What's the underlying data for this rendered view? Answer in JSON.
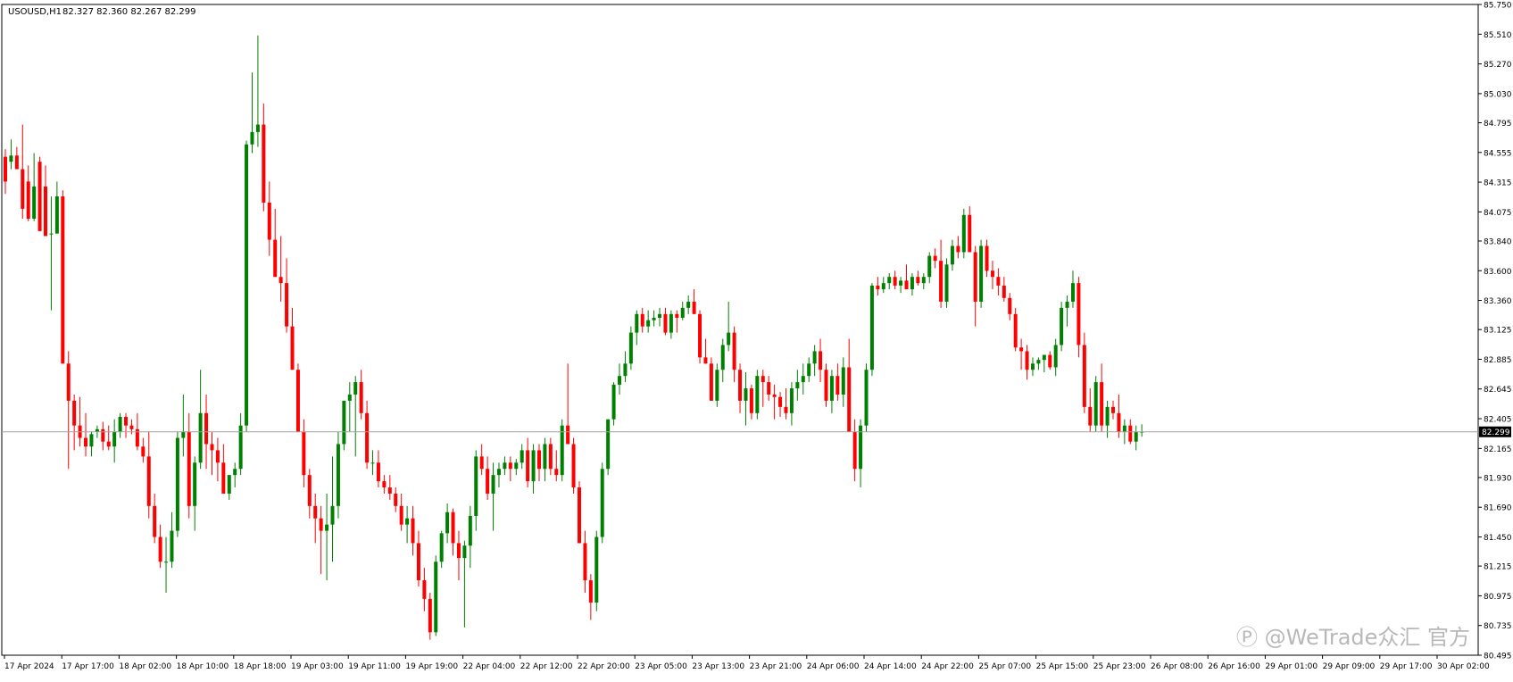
{
  "header": {
    "symbol": "USOUSD,H1",
    "ohlc": "82.327 82.360 82.267 82.299"
  },
  "watermark": "Ⓟ @WeTrade众汇 官方",
  "colors": {
    "bull": "#008000",
    "bear": "#ff0000",
    "wick_bull": "#008000",
    "wick_bear": "#ff0000",
    "bid_line": "#a0a0a0",
    "axis": "#000000",
    "price_label_bg": "#000000",
    "price_label_fg": "#ffffff"
  },
  "chart_data": {
    "type": "candlestick",
    "title": "",
    "current_price": 82.299,
    "current_price_label": "82.299",
    "ylim": [
      80.495,
      85.75
    ],
    "y_ticks": [
      "85.750",
      "85.510",
      "85.270",
      "85.030",
      "84.795",
      "84.555",
      "84.315",
      "84.075",
      "83.840",
      "83.600",
      "83.360",
      "83.125",
      "82.885",
      "82.645",
      "82.405",
      "82.165",
      "81.930",
      "81.690",
      "81.450",
      "81.215",
      "80.975",
      "80.735",
      "80.495"
    ],
    "x_ticks": [
      "17 Apr 2024",
      "17 Apr 17:00",
      "18 Apr 02:00",
      "18 Apr 10:00",
      "18 Apr 18:00",
      "19 Apr 03:00",
      "19 Apr 11:00",
      "19 Apr 19:00",
      "22 Apr 04:00",
      "22 Apr 12:00",
      "22 Apr 20:00",
      "23 Apr 05:00",
      "23 Apr 13:00",
      "23 Apr 21:00",
      "24 Apr 06:00",
      "24 Apr 14:00",
      "24 Apr 22:00",
      "25 Apr 07:00",
      "25 Apr 15:00",
      "25 Apr 23:00",
      "26 Apr 08:00",
      "26 Apr 16:00",
      "29 Apr 01:00",
      "29 Apr 09:00",
      "29 Apr 17:00",
      "30 Apr 02:00"
    ],
    "candles": [
      [
        84.52,
        84.58,
        84.22,
        84.32
      ],
      [
        84.48,
        84.66,
        84.42,
        84.53
      ],
      [
        84.53,
        84.6,
        84.42,
        84.42
      ],
      [
        84.42,
        84.78,
        84.02,
        84.1
      ],
      [
        84.32,
        84.45,
        84.0,
        84.02
      ],
      [
        84.02,
        84.55,
        84.0,
        84.28
      ],
      [
        84.48,
        84.52,
        83.92,
        83.92
      ],
      [
        84.28,
        84.45,
        83.88,
        83.88
      ],
      [
        83.9,
        84.2,
        83.28,
        83.9
      ],
      [
        83.9,
        84.32,
        83.9,
        84.2
      ],
      [
        84.2,
        84.25,
        82.85,
        82.85
      ],
      [
        82.85,
        82.95,
        82.0,
        82.55
      ],
      [
        82.55,
        82.6,
        82.15,
        82.35
      ],
      [
        82.35,
        82.58,
        82.18,
        82.25
      ],
      [
        82.25,
        82.45,
        82.1,
        82.18
      ],
      [
        82.18,
        82.3,
        82.1,
        82.28
      ],
      [
        82.3,
        82.35,
        82.25,
        82.32
      ],
      [
        82.32,
        82.38,
        82.15,
        82.22
      ],
      [
        82.22,
        82.35,
        82.15,
        82.18
      ],
      [
        82.18,
        82.4,
        82.05,
        82.3
      ],
      [
        82.3,
        82.45,
        82.25,
        82.42
      ],
      [
        82.42,
        82.45,
        82.25,
        82.35
      ],
      [
        82.35,
        82.4,
        82.28,
        82.32
      ],
      [
        82.32,
        82.45,
        82.15,
        82.18
      ],
      [
        82.18,
        82.25,
        82.05,
        82.1
      ],
      [
        82.1,
        82.3,
        81.6,
        81.7
      ],
      [
        81.7,
        81.8,
        81.4,
        81.45
      ],
      [
        81.45,
        81.55,
        81.2,
        81.25
      ],
      [
        81.25,
        81.45,
        81.0,
        81.25
      ],
      [
        81.25,
        81.65,
        81.2,
        81.5
      ],
      [
        81.5,
        82.3,
        81.45,
        82.25
      ],
      [
        82.25,
        82.6,
        82.1,
        82.3
      ],
      [
        82.3,
        82.45,
        81.6,
        81.7
      ],
      [
        81.7,
        82.1,
        81.5,
        82.05
      ],
      [
        82.05,
        82.8,
        82.0,
        82.45
      ],
      [
        82.45,
        82.6,
        82.0,
        82.2
      ],
      [
        82.2,
        82.3,
        81.95,
        82.15
      ],
      [
        82.15,
        82.25,
        81.9,
        82.05
      ],
      [
        82.05,
        82.2,
        81.85,
        81.8
      ],
      [
        81.8,
        81.95,
        81.75,
        81.95
      ],
      [
        81.95,
        82.05,
        81.85,
        82.0
      ],
      [
        82.0,
        82.45,
        81.95,
        82.35
      ],
      [
        82.35,
        84.65,
        82.3,
        84.62
      ],
      [
        84.62,
        85.2,
        84.55,
        84.72
      ],
      [
        84.72,
        85.5,
        84.6,
        84.78
      ],
      [
        84.78,
        84.95,
        84.08,
        84.15
      ],
      [
        84.15,
        84.32,
        83.72,
        83.85
      ],
      [
        83.85,
        84.1,
        83.55,
        83.55
      ],
      [
        83.55,
        83.88,
        83.35,
        83.5
      ],
      [
        83.5,
        83.7,
        83.1,
        83.15
      ],
      [
        83.15,
        83.3,
        82.8,
        82.8
      ],
      [
        82.8,
        82.85,
        82.3,
        82.3
      ],
      [
        82.3,
        82.4,
        81.85,
        81.95
      ],
      [
        81.95,
        82.0,
        81.6,
        81.7
      ],
      [
        81.7,
        81.8,
        81.4,
        81.6
      ],
      [
        81.6,
        81.7,
        81.15,
        81.5
      ],
      [
        81.5,
        81.8,
        81.1,
        81.55
      ],
      [
        81.55,
        82.1,
        81.25,
        81.7
      ],
      [
        81.7,
        82.3,
        81.6,
        82.2
      ],
      [
        82.2,
        82.55,
        82.15,
        82.55
      ],
      [
        82.55,
        82.7,
        82.3,
        82.6
      ],
      [
        82.6,
        82.75,
        82.1,
        82.7
      ],
      [
        82.7,
        82.8,
        82.4,
        82.45
      ],
      [
        82.45,
        82.55,
        82.0,
        82.05
      ],
      [
        82.05,
        82.15,
        81.95,
        82.05
      ],
      [
        82.05,
        82.15,
        81.85,
        81.9
      ],
      [
        81.9,
        81.95,
        81.8,
        81.85
      ],
      [
        81.85,
        81.95,
        81.75,
        81.8
      ],
      [
        81.8,
        81.85,
        81.65,
        81.7
      ],
      [
        81.7,
        81.8,
        81.5,
        81.55
      ],
      [
        81.55,
        81.7,
        81.4,
        81.6
      ],
      [
        81.6,
        81.7,
        81.3,
        81.4
      ],
      [
        81.4,
        81.5,
        81.05,
        81.1
      ],
      [
        81.1,
        81.2,
        80.85,
        80.95
      ],
      [
        80.95,
        81.0,
        80.62,
        80.68
      ],
      [
        80.68,
        81.3,
        80.65,
        81.25
      ],
      [
        81.25,
        81.5,
        81.2,
        81.48
      ],
      [
        81.48,
        81.72,
        81.4,
        81.65
      ],
      [
        81.65,
        81.68,
        81.3,
        81.4
      ],
      [
        81.4,
        81.5,
        81.1,
        81.28
      ],
      [
        81.28,
        81.42,
        80.72,
        81.38
      ],
      [
        81.38,
        81.7,
        81.2,
        81.62
      ],
      [
        81.62,
        82.15,
        81.5,
        82.1
      ],
      [
        82.1,
        82.2,
        81.95,
        82.0
      ],
      [
        82.0,
        82.1,
        81.75,
        81.8
      ],
      [
        81.8,
        82.05,
        81.5,
        81.95
      ],
      [
        81.95,
        82.05,
        81.85,
        82.0
      ],
      [
        82.0,
        82.1,
        81.95,
        82.05
      ],
      [
        82.05,
        82.1,
        81.9,
        82.0
      ],
      [
        82.0,
        82.08,
        81.95,
        82.05
      ],
      [
        82.05,
        82.2,
        82.0,
        82.15
      ],
      [
        82.15,
        82.25,
        81.85,
        81.9
      ],
      [
        81.9,
        82.2,
        81.8,
        82.15
      ],
      [
        82.15,
        82.2,
        81.9,
        82.0
      ],
      [
        82.0,
        82.25,
        81.9,
        82.2
      ],
      [
        82.2,
        82.25,
        81.95,
        82.0
      ],
      [
        82.0,
        82.15,
        81.9,
        81.95
      ],
      [
        81.95,
        82.4,
        81.9,
        82.35
      ],
      [
        82.35,
        82.85,
        82.2,
        82.2
      ],
      [
        82.2,
        82.25,
        81.8,
        81.85
      ],
      [
        81.85,
        81.9,
        81.4,
        81.4
      ],
      [
        81.4,
        81.5,
        81.0,
        81.1
      ],
      [
        81.1,
        81.15,
        80.78,
        80.92
      ],
      [
        80.92,
        81.5,
        80.85,
        81.45
      ],
      [
        81.45,
        82.05,
        81.4,
        82.0
      ],
      [
        82.0,
        82.4,
        81.95,
        82.4
      ],
      [
        82.4,
        82.7,
        82.35,
        82.68
      ],
      [
        82.68,
        82.85,
        82.6,
        82.75
      ],
      [
        82.75,
        82.95,
        82.7,
        82.85
      ],
      [
        82.85,
        83.15,
        82.8,
        83.1
      ],
      [
        83.1,
        83.28,
        83.0,
        83.25
      ],
      [
        83.25,
        83.3,
        83.1,
        83.15
      ],
      [
        83.15,
        83.28,
        83.1,
        83.2
      ],
      [
        83.2,
        83.28,
        83.15,
        83.22
      ],
      [
        83.22,
        83.3,
        83.15,
        83.25
      ],
      [
        83.25,
        83.3,
        83.08,
        83.1
      ],
      [
        83.1,
        83.28,
        83.05,
        83.25
      ],
      [
        83.25,
        83.28,
        83.1,
        83.22
      ],
      [
        83.22,
        83.35,
        83.2,
        83.3
      ],
      [
        83.3,
        83.4,
        83.25,
        83.35
      ],
      [
        83.35,
        83.45,
        83.25,
        83.25
      ],
      [
        83.25,
        83.28,
        82.85,
        82.9
      ],
      [
        82.9,
        83.05,
        82.85,
        82.85
      ],
      [
        82.85,
        82.9,
        82.55,
        82.55
      ],
      [
        82.55,
        82.85,
        82.5,
        82.8
      ],
      [
        82.8,
        83.05,
        82.7,
        83.0
      ],
      [
        83.0,
        83.35,
        82.95,
        83.1
      ],
      [
        83.1,
        83.15,
        82.7,
        82.8
      ],
      [
        82.8,
        82.85,
        82.45,
        82.55
      ],
      [
        82.55,
        82.78,
        82.35,
        82.65
      ],
      [
        82.65,
        82.68,
        82.4,
        82.45
      ],
      [
        82.45,
        82.8,
        82.4,
        82.75
      ],
      [
        82.75,
        82.8,
        82.5,
        82.7
      ],
      [
        82.7,
        82.75,
        82.55,
        82.6
      ],
      [
        82.6,
        82.68,
        82.4,
        82.58
      ],
      [
        82.58,
        82.62,
        82.42,
        82.5
      ],
      [
        82.5,
        82.65,
        82.4,
        82.45
      ],
      [
        82.45,
        82.7,
        82.35,
        82.65
      ],
      [
        82.65,
        82.8,
        82.55,
        82.7
      ],
      [
        82.7,
        82.85,
        82.6,
        82.75
      ],
      [
        82.75,
        82.9,
        82.7,
        82.85
      ],
      [
        82.85,
        83.0,
        82.75,
        82.95
      ],
      [
        82.95,
        83.05,
        82.7,
        82.8
      ],
      [
        82.8,
        82.85,
        82.5,
        82.55
      ],
      [
        82.55,
        82.8,
        82.45,
        82.75
      ],
      [
        82.75,
        82.85,
        82.55,
        82.6
      ],
      [
        82.6,
        82.9,
        82.5,
        82.82
      ],
      [
        82.82,
        83.05,
        82.35,
        82.3
      ],
      [
        82.3,
        82.4,
        81.9,
        82.0
      ],
      [
        82.0,
        82.4,
        81.85,
        82.35
      ],
      [
        82.35,
        82.85,
        82.3,
        82.8
      ],
      [
        82.8,
        83.5,
        82.75,
        83.48
      ],
      [
        83.48,
        83.55,
        83.4,
        83.45
      ],
      [
        83.45,
        83.55,
        83.42,
        83.5
      ],
      [
        83.5,
        83.58,
        83.45,
        83.55
      ],
      [
        83.55,
        83.6,
        83.45,
        83.48
      ],
      [
        83.48,
        83.55,
        83.42,
        83.52
      ],
      [
        83.52,
        83.65,
        83.45,
        83.45
      ],
      [
        83.45,
        83.58,
        83.4,
        83.55
      ],
      [
        83.55,
        83.6,
        83.48,
        83.5
      ],
      [
        83.5,
        83.58,
        83.45,
        83.55
      ],
      [
        83.55,
        83.75,
        83.5,
        83.72
      ],
      [
        83.72,
        83.78,
        83.62,
        83.68
      ],
      [
        83.68,
        83.85,
        83.3,
        83.35
      ],
      [
        83.35,
        83.7,
        83.3,
        83.65
      ],
      [
        83.65,
        83.85,
        83.6,
        83.8
      ],
      [
        83.8,
        83.88,
        83.7,
        83.75
      ],
      [
        83.75,
        84.1,
        83.7,
        84.05
      ],
      [
        84.05,
        84.12,
        83.75,
        83.75
      ],
      [
        83.75,
        83.8,
        83.15,
        83.35
      ],
      [
        83.35,
        83.85,
        83.3,
        83.8
      ],
      [
        83.8,
        83.85,
        83.55,
        83.6
      ],
      [
        83.6,
        83.68,
        83.45,
        83.55
      ],
      [
        83.55,
        83.62,
        83.4,
        83.48
      ],
      [
        83.48,
        83.55,
        83.35,
        83.38
      ],
      [
        83.38,
        83.42,
        83.2,
        83.25
      ],
      [
        83.25,
        83.3,
        82.95,
        82.98
      ],
      [
        82.98,
        83.05,
        82.8,
        82.95
      ],
      [
        82.95,
        83.0,
        82.72,
        82.8
      ],
      [
        82.8,
        82.9,
        82.75,
        82.85
      ],
      [
        82.85,
        82.9,
        82.8,
        82.88
      ],
      [
        82.88,
        82.92,
        82.78,
        82.92
      ],
      [
        82.92,
        82.95,
        82.8,
        82.82
      ],
      [
        82.82,
        83.05,
        82.75,
        83.0
      ],
      [
        83.0,
        83.35,
        82.95,
        83.3
      ],
      [
        83.3,
        83.4,
        83.15,
        83.35
      ],
      [
        83.35,
        83.6,
        83.3,
        83.5
      ],
      [
        83.5,
        83.55,
        82.9,
        83.0
      ],
      [
        83.0,
        83.1,
        82.45,
        82.5
      ],
      [
        82.5,
        82.65,
        82.3,
        82.35
      ],
      [
        82.35,
        82.75,
        82.3,
        82.7
      ],
      [
        82.7,
        82.85,
        82.3,
        82.35
      ],
      [
        82.35,
        82.55,
        82.25,
        82.5
      ],
      [
        82.5,
        82.55,
        82.4,
        82.45
      ],
      [
        82.45,
        82.6,
        82.25,
        82.3
      ],
      [
        82.3,
        82.4,
        82.2,
        82.35
      ],
      [
        82.35,
        82.4,
        82.2,
        82.22
      ],
      [
        82.22,
        82.35,
        82.15,
        82.3
      ],
      [
        82.3,
        82.36,
        82.26,
        82.3
      ]
    ]
  }
}
